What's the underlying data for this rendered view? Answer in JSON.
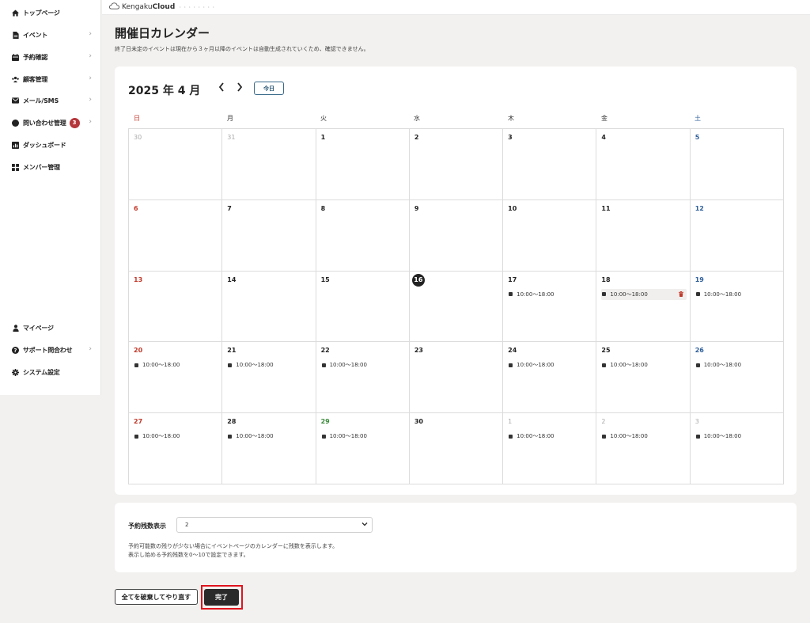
{
  "sidebar": {
    "items": [
      {
        "label": "トップページ",
        "icon": "home-icon",
        "chevron": false
      },
      {
        "label": "イベント",
        "icon": "document-icon",
        "chevron": true
      },
      {
        "label": "予約確認",
        "icon": "calendar-icon",
        "chevron": true
      },
      {
        "label": "顧客管理",
        "icon": "users-icon",
        "chevron": true
      },
      {
        "label": "メール/SMS",
        "icon": "mail-icon",
        "chevron": true
      },
      {
        "label": "問い合わせ管理",
        "icon": "chat-icon",
        "chevron": true,
        "badge": "3"
      },
      {
        "label": "ダッシュボード",
        "icon": "chart-icon",
        "chevron": false
      },
      {
        "label": "メンバー管理",
        "icon": "grid-icon",
        "chevron": false
      }
    ],
    "bottom_items": [
      {
        "label": "マイページ",
        "icon": "user-icon",
        "chevron": false
      },
      {
        "label": "サポート問合わせ",
        "icon": "help-icon",
        "chevron": true
      },
      {
        "label": "システム設定",
        "icon": "gear-icon",
        "chevron": false
      }
    ]
  },
  "header": {
    "logo_prefix": "Kengaku",
    "logo_bold": "Cloud",
    "logo_dots": "・・・・・・・・"
  },
  "page": {
    "title": "開催日カレンダー",
    "description": "終了日未定のイベントは現在から３ヶ月以降のイベントは自動生成されていくため、確認できません。"
  },
  "calendar": {
    "month_label": "2025 年 4 月",
    "prev": "‹",
    "next": "›",
    "today_label": "今日",
    "weekdays": [
      "日",
      "月",
      "火",
      "水",
      "木",
      "金",
      "土"
    ],
    "event_time": "10:00〜18:00",
    "days": [
      {
        "d": "30",
        "muted": true
      },
      {
        "d": "31",
        "muted": true
      },
      {
        "d": "1"
      },
      {
        "d": "2"
      },
      {
        "d": "3"
      },
      {
        "d": "4"
      },
      {
        "d": "5"
      },
      {
        "d": "6"
      },
      {
        "d": "7"
      },
      {
        "d": "8"
      },
      {
        "d": "9"
      },
      {
        "d": "10"
      },
      {
        "d": "11"
      },
      {
        "d": "12"
      },
      {
        "d": "13"
      },
      {
        "d": "14"
      },
      {
        "d": "15"
      },
      {
        "d": "16",
        "today": true
      },
      {
        "d": "17",
        "event": true
      },
      {
        "d": "18",
        "event": true,
        "selected": true
      },
      {
        "d": "19",
        "event": true
      },
      {
        "d": "20",
        "event": true
      },
      {
        "d": "21",
        "event": true
      },
      {
        "d": "22",
        "event": true
      },
      {
        "d": "23"
      },
      {
        "d": "24",
        "event": true
      },
      {
        "d": "25",
        "event": true
      },
      {
        "d": "26",
        "event": true
      },
      {
        "d": "27",
        "event": true
      },
      {
        "d": "28",
        "event": true
      },
      {
        "d": "29",
        "event": true,
        "holiday": true
      },
      {
        "d": "30"
      },
      {
        "d": "1",
        "event": true,
        "muted": true
      },
      {
        "d": "2",
        "event": true,
        "muted": true
      },
      {
        "d": "3",
        "event": true,
        "muted": true
      }
    ]
  },
  "settings": {
    "label": "予約残数表示",
    "select_value": "2",
    "help1": "予約可能数の残りが少ない場合にイベントページのカレンダーに残数を表示します。",
    "help2": "表示し始める予約残数を0〜10で設定できます。"
  },
  "actions": {
    "reset_label": "全てを破棄してやり直す",
    "done_label": "完了"
  },
  "colors": {
    "sunday": "#c0392b",
    "saturday": "#2e5f9a",
    "holiday": "#3a8a3a",
    "badge": "#b5363b",
    "highlight": "#e0141e",
    "primary_button": "#2a2a2a"
  }
}
